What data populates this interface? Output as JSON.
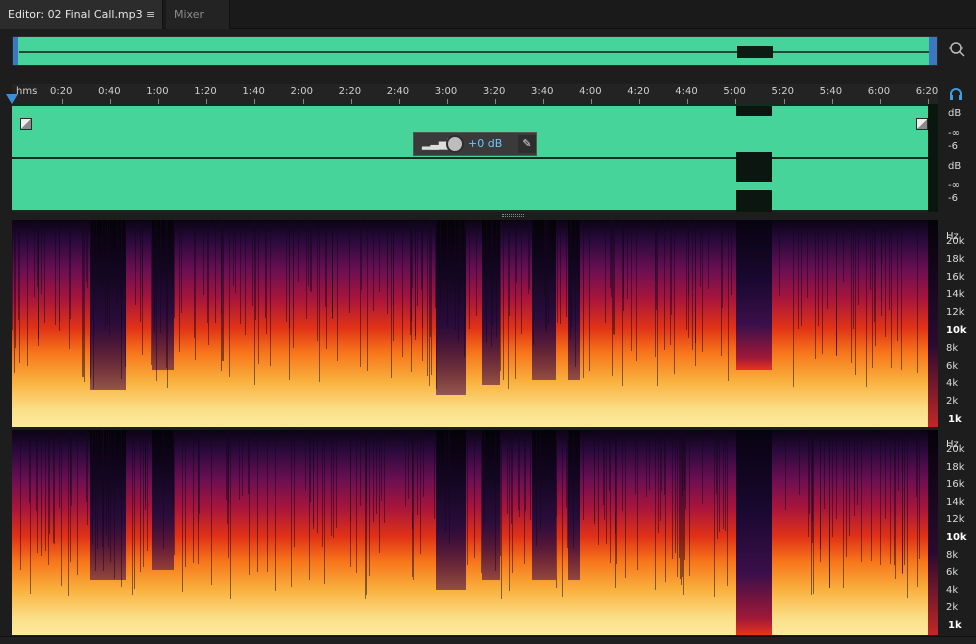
{
  "tabs": {
    "editor_label": "Editor: 02 Final Call.mp3",
    "editor_menu_glyph": "≡",
    "mixer_label": "Mixer"
  },
  "icons": {
    "zoom": "zoom-icon",
    "headphones": "headphones-icon",
    "playhead": "playhead-icon",
    "fade": "fade-handle-icon",
    "pin": "pin-icon"
  },
  "ruler": {
    "unit": "hms",
    "ticks": [
      "0:20",
      "0:40",
      "1:00",
      "1:20",
      "1:40",
      "2:00",
      "2:20",
      "2:40",
      "3:00",
      "3:20",
      "3:40",
      "4:00",
      "4:20",
      "4:40",
      "5:00",
      "5:20",
      "5:40",
      "6:00",
      "6:20"
    ]
  },
  "hud": {
    "volume": "+0 dB"
  },
  "level_scale": {
    "ch1": [
      "dB",
      "-∞",
      "-6"
    ],
    "ch2": [
      "dB",
      "-∞",
      "-6"
    ]
  },
  "spectral_scale": {
    "unit": "Hz",
    "labels": [
      "20k",
      "18k",
      "16k",
      "14k",
      "12k",
      "10k",
      "8k",
      "6k",
      "4k",
      "2k",
      "1k"
    ]
  },
  "colors": {
    "waveform": "#46d49a",
    "accent": "#3a8fd8",
    "hud_value": "#6cc6ff"
  }
}
